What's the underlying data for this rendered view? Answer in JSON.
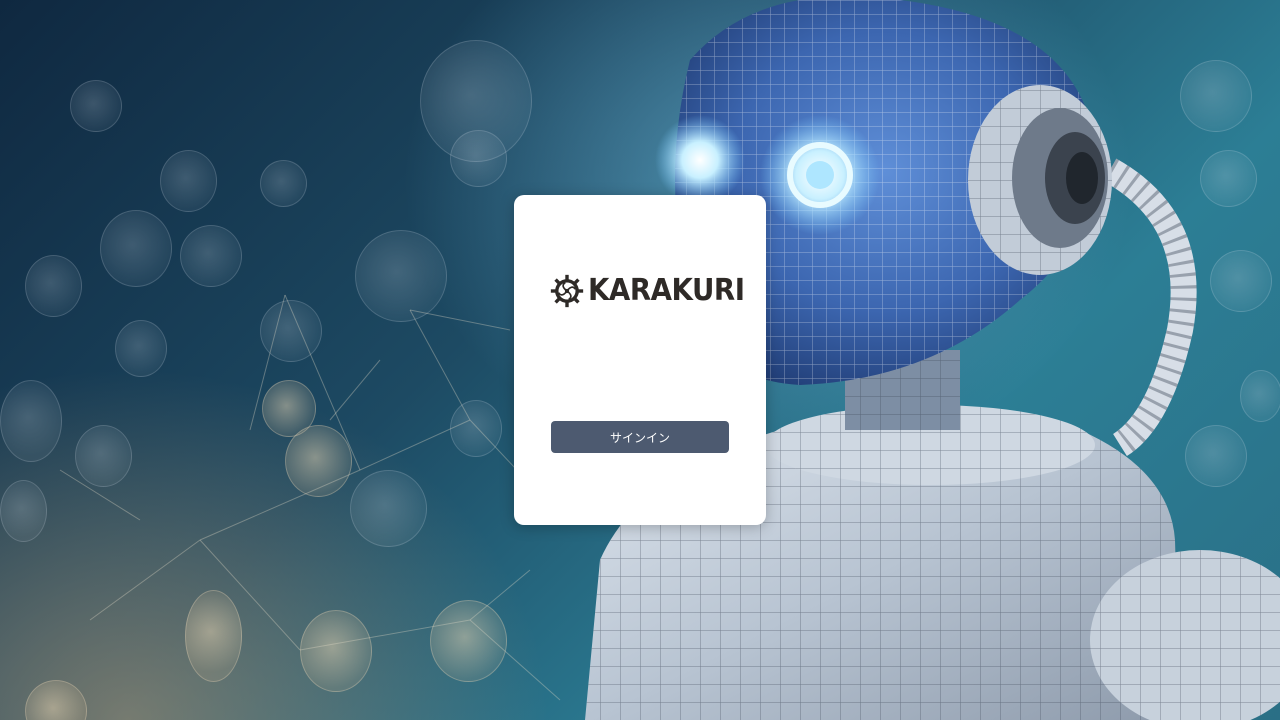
{
  "brand": {
    "logo_text": "KARAKURI",
    "logo_icon": "gear-icon",
    "logo_color": "#2e2a27"
  },
  "signin": {
    "button_label": "サインイン",
    "button_color": "#4d5a70"
  },
  "background": {
    "description_icon": "robot-illustration",
    "accent": "#2c7e95"
  }
}
